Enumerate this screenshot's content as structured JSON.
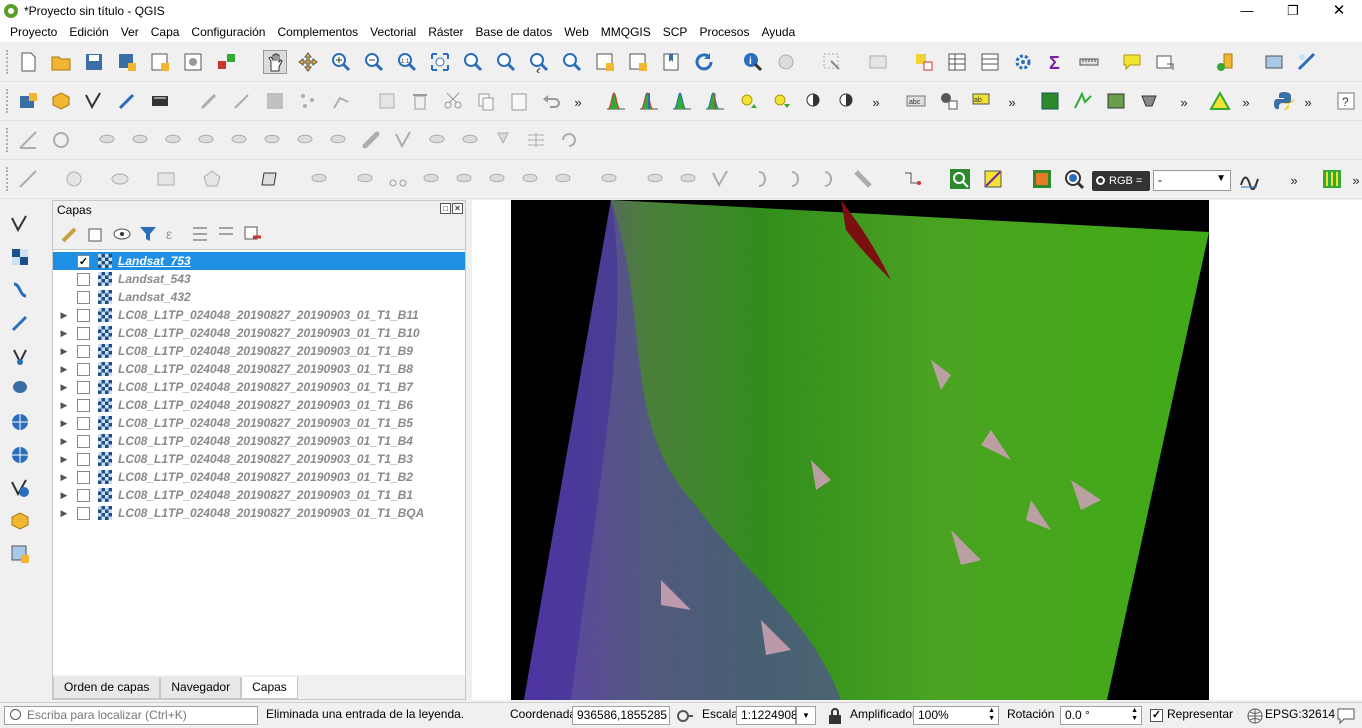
{
  "window": {
    "title": "*Proyecto sin título - QGIS"
  },
  "menu": [
    "Proyecto",
    "Edición",
    "Ver",
    "Capa",
    "Configuración",
    "Complementos",
    "Vectorial",
    "Ráster",
    "Base de datos",
    "Web",
    "MMQGIS",
    "SCP",
    "Procesos",
    "Ayuda"
  ],
  "toolbar": {
    "rgb_label": "RGB =",
    "rgb_select_value": "-"
  },
  "layers_panel": {
    "title": "Capas",
    "layers": [
      {
        "name": "Landsat_753",
        "checked": true,
        "selected": true,
        "expandable": false
      },
      {
        "name": "Landsat_543",
        "checked": false,
        "selected": false,
        "expandable": false
      },
      {
        "name": "Landsat_432",
        "checked": false,
        "selected": false,
        "expandable": false
      },
      {
        "name": "LC08_L1TP_024048_20190827_20190903_01_T1_B11",
        "checked": false,
        "selected": false,
        "expandable": true
      },
      {
        "name": "LC08_L1TP_024048_20190827_20190903_01_T1_B10",
        "checked": false,
        "selected": false,
        "expandable": true
      },
      {
        "name": "LC08_L1TP_024048_20190827_20190903_01_T1_B9",
        "checked": false,
        "selected": false,
        "expandable": true
      },
      {
        "name": "LC08_L1TP_024048_20190827_20190903_01_T1_B8",
        "checked": false,
        "selected": false,
        "expandable": true
      },
      {
        "name": "LC08_L1TP_024048_20190827_20190903_01_T1_B7",
        "checked": false,
        "selected": false,
        "expandable": true
      },
      {
        "name": "LC08_L1TP_024048_20190827_20190903_01_T1_B6",
        "checked": false,
        "selected": false,
        "expandable": true
      },
      {
        "name": "LC08_L1TP_024048_20190827_20190903_01_T1_B5",
        "checked": false,
        "selected": false,
        "expandable": true
      },
      {
        "name": "LC08_L1TP_024048_20190827_20190903_01_T1_B4",
        "checked": false,
        "selected": false,
        "expandable": true
      },
      {
        "name": "LC08_L1TP_024048_20190827_20190903_01_T1_B3",
        "checked": false,
        "selected": false,
        "expandable": true
      },
      {
        "name": "LC08_L1TP_024048_20190827_20190903_01_T1_B2",
        "checked": false,
        "selected": false,
        "expandable": true
      },
      {
        "name": "LC08_L1TP_024048_20190827_20190903_01_T1_B1",
        "checked": false,
        "selected": false,
        "expandable": true
      },
      {
        "name": "LC08_L1TP_024048_20190827_20190903_01_T1_BQA",
        "checked": false,
        "selected": false,
        "expandable": true
      }
    ],
    "tabs": [
      "Orden de capas",
      "Navegador",
      "Capas"
    ]
  },
  "statusbar": {
    "locator_placeholder": "Escriba para localizar (Ctrl+K)",
    "message": "Eliminada una entrada de la leyenda.",
    "coord_label": "Coordenada",
    "coord_value": "936586,1855285",
    "scale_label": "Escala",
    "scale_value": "1:1224908",
    "magnifier_label": "Amplificador",
    "magnifier_value": "100%",
    "rotation_label": "Rotación",
    "rotation_value": "0.0 °",
    "render_label": "Representar",
    "crs": "EPSG:32614"
  }
}
